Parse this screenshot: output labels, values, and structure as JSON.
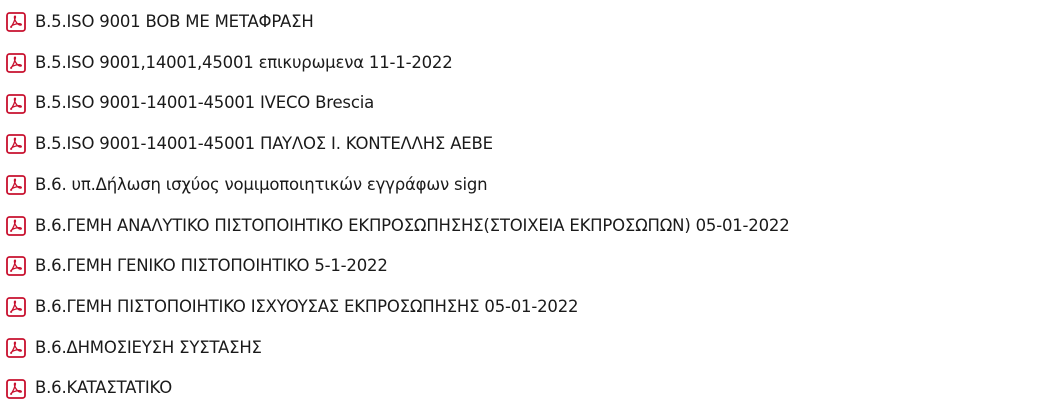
{
  "files": [
    {
      "name": "B.5.ISO 9001 BOB ME METAΦPAΣH",
      "icon": "pdf-file-icon"
    },
    {
      "name": "B.5.ISO 9001,14001,45001 επικυρωμενα 11-1-2022",
      "icon": "pdf-file-icon"
    },
    {
      "name": "B.5.ISO 9001-14001-45001 IVECO Brescia",
      "icon": "pdf-file-icon"
    },
    {
      "name": "B.5.ISO 9001-14001-45001 ΠAYΛOΣ I. KONTEΛΛHΣ AEBE",
      "icon": "pdf-file-icon"
    },
    {
      "name": "B.6. υπ.Δήλωση ισχύος νομιμοποιητικών εγγράφων sign",
      "icon": "pdf-file-icon"
    },
    {
      "name": "B.6.ΓEMH ANAΛYTIKO ΠIΣTOΠOIHTIKO EKΠPOΣΩΠHΣHΣ(ΣTOIXEIA EKΠPOΣΩΠΩN) 05-01-2022",
      "icon": "pdf-file-icon"
    },
    {
      "name": "B.6.ΓEMH ΓENIKO ΠIΣTOΠOIHTIKO 5-1-2022",
      "icon": "pdf-file-icon"
    },
    {
      "name": "B.6.ΓEMH ΠIΣTOΠOIHTIKO IΣXYOYΣAΣ EKΠPOΣΩΠHΣHΣ 05-01-2022",
      "icon": "pdf-file-icon"
    },
    {
      "name": "B.6.ΔHMOΣIEYΣH ΣYΣTAΣHΣ",
      "icon": "pdf-file-icon"
    },
    {
      "name": "B.6.KATAΣTATIKO",
      "icon": "pdf-file-icon"
    }
  ],
  "colors": {
    "pdf_icon_border": "#c8102e",
    "pdf_icon_fill": "#ffffff",
    "text": "#1a1a1a"
  }
}
